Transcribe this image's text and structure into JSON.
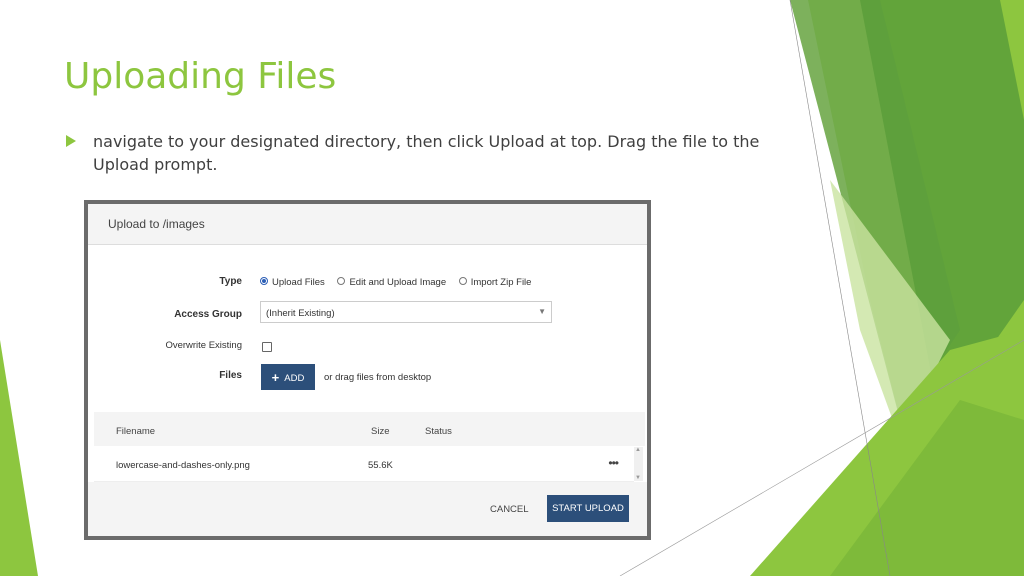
{
  "slide": {
    "title": "Uploading Files",
    "bullet": "navigate to your designated directory, then click Upload at top. Drag the file to the Upload prompt.",
    "accent_color": "#8DC63F"
  },
  "dialog": {
    "title": "Upload to /images",
    "type_label": "Type",
    "type_options": [
      "Upload Files",
      "Edit and Upload Image",
      "Import Zip File"
    ],
    "type_selected": "Upload Files",
    "access_group_label": "Access Group",
    "access_group_value": "(Inherit Existing)",
    "overwrite_label": "Overwrite Existing",
    "overwrite_checked": false,
    "files_label": "Files",
    "add_button": "ADD",
    "drag_hint": "or drag files from desktop",
    "table": {
      "columns": [
        "Filename",
        "Size",
        "Status"
      ],
      "rows": [
        {
          "filename": "lowercase-and-dashes-only.png",
          "size": "55.6K",
          "status": ""
        }
      ],
      "row_menu": "•••"
    },
    "cancel_button": "CANCEL",
    "start_button": "START UPLOAD",
    "button_color": "#2c4f7a"
  }
}
